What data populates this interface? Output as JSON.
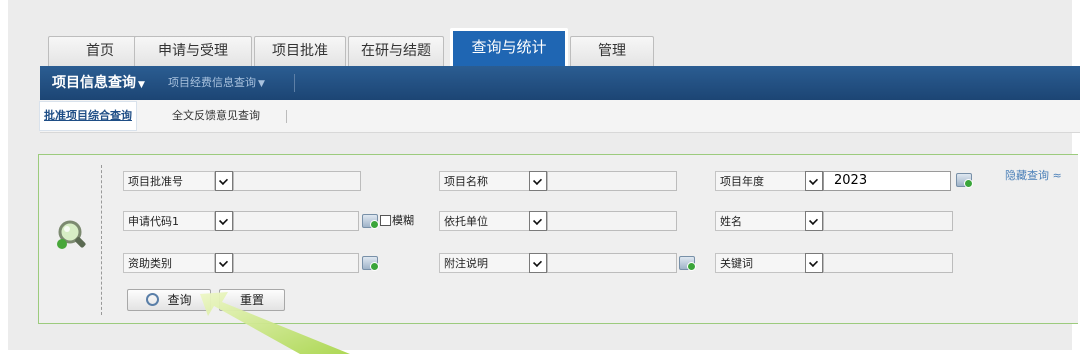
{
  "tabs": [
    {
      "label": "首页"
    },
    {
      "label": "申请与受理"
    },
    {
      "label": "项目批准"
    },
    {
      "label": "在研与结题"
    },
    {
      "label": "查询与统计"
    },
    {
      "label": "管理"
    }
  ],
  "active_tab": "查询与统计",
  "nav": {
    "main_label": "项目信息查询",
    "sub_label": "项目经费信息查询"
  },
  "subnav": {
    "active_label": "批准项目综合查询",
    "item_label": "全文反馈意见查询"
  },
  "query": {
    "fields": {
      "approval_no": {
        "label": "项目批准号",
        "value": ""
      },
      "project_name": {
        "label": "项目名称",
        "value": ""
      },
      "project_year": {
        "label": "项目年度",
        "value": "2023"
      },
      "apply_code": {
        "label": "申请代码1",
        "value": ""
      },
      "entrust_unit": {
        "label": "依托单位",
        "value": ""
      },
      "name": {
        "label": "姓名",
        "value": ""
      },
      "funding_type": {
        "label": "资助类别",
        "value": ""
      },
      "note": {
        "label": "附注说明",
        "value": ""
      },
      "keyword": {
        "label": "关键词",
        "value": ""
      }
    },
    "fuzzy_label": "模糊",
    "hide_query_label": "隐藏查询",
    "search_button": "查询",
    "reset_button": "重置"
  },
  "colors": {
    "nav_bar": "#1c4574",
    "active_tab": "#1f66b3",
    "panel_border": "#9ccb7d",
    "annotation_arrow": "#bfe36b"
  },
  "icons": [
    "magnifier-icon",
    "dropdown-arrow-icon",
    "picker-icon",
    "chevron-up-icon",
    "search-icon"
  ]
}
